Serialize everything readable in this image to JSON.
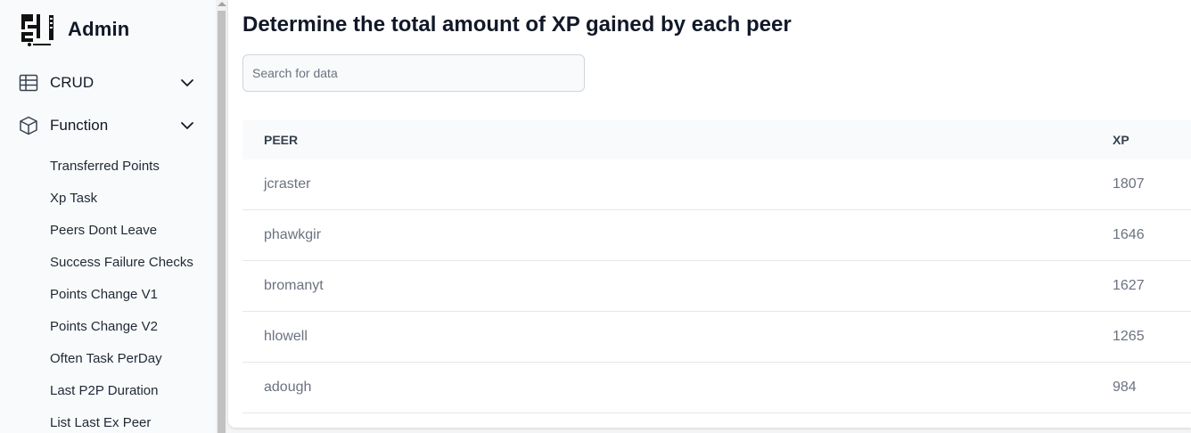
{
  "sidebar": {
    "brand_title": "Admin",
    "groups": [
      {
        "label": "CRUD",
        "icon": "table-icon"
      },
      {
        "label": "Function",
        "icon": "cube-icon"
      }
    ],
    "function_items": [
      "Transferred Points",
      "Xp Task",
      "Peers Dont Leave",
      "Success Failure Checks",
      "Points Change V1",
      "Points Change V2",
      "Often Task PerDay",
      "Last P2P Duration",
      "List Last Ex Peer"
    ]
  },
  "main": {
    "title": "Determine the total amount of XP gained by each peer",
    "search": {
      "placeholder": "Search for data",
      "value": ""
    },
    "table": {
      "columns": [
        "PEER",
        "XP"
      ],
      "rows": [
        {
          "peer": "jcraster",
          "xp": "1807"
        },
        {
          "peer": "phawkgir",
          "xp": "1646"
        },
        {
          "peer": "bromanyt",
          "xp": "1627"
        },
        {
          "peer": "hlowell",
          "xp": "1265"
        },
        {
          "peer": "adough",
          "xp": "984"
        }
      ]
    }
  },
  "colors": {
    "sidebar_bg": "#f9fafb",
    "page_bg": "#ffffff",
    "header_bg": "#f9fafb",
    "text_dark": "#111827",
    "text_muted": "#6b7280",
    "divider": "#e5e7eb"
  }
}
